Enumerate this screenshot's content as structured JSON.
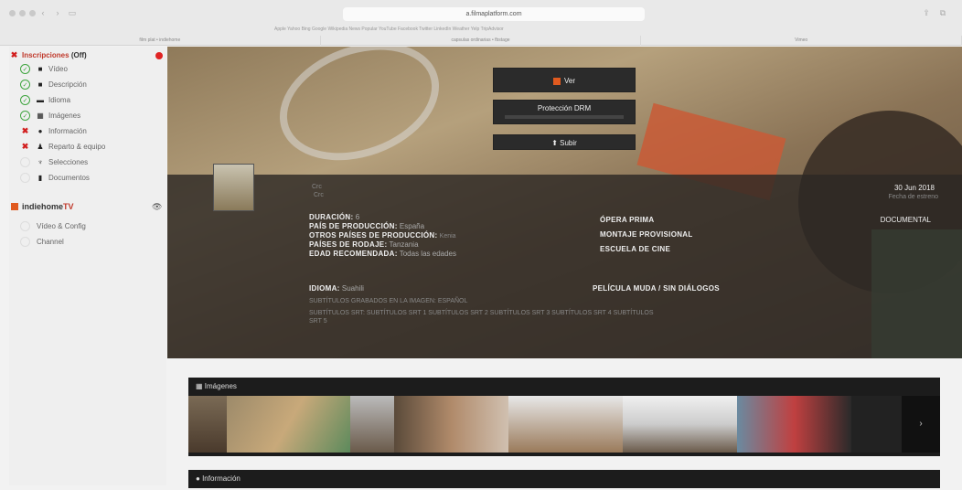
{
  "browser": {
    "url": "a.filmaplatform.com",
    "bookmarks": "Apple  Yahoo  Bing  Google  Wikipedia  News  Popular  YouTube  Facebook  Twitter  LinkedIn  Weather  Yelp  TripAdvisor",
    "tabs": [
      "film plat • indiehome",
      "capsulas ordinarias • fbstage",
      "Vimeo"
    ]
  },
  "sidebar": {
    "inscripciones_title": "Inscripciones",
    "inscripciones_status": "(Off)",
    "items": [
      {
        "label": "Vídeo",
        "state": "ok",
        "icon": "document-icon"
      },
      {
        "label": "Descripción",
        "state": "ok",
        "icon": "document-icon"
      },
      {
        "label": "Idioma",
        "state": "ok",
        "icon": "language-icon"
      },
      {
        "label": "Imágenes",
        "state": "ok",
        "icon": "image-icon"
      },
      {
        "label": "Información",
        "state": "bad",
        "icon": "info-icon"
      },
      {
        "label": "Reparto & equipo",
        "state": "bad",
        "icon": "people-icon"
      },
      {
        "label": "Selecciones",
        "state": "empty",
        "icon": "trophy-icon"
      },
      {
        "label": "Documentos",
        "state": "empty",
        "icon": "file-icon"
      }
    ],
    "indiehome_title": "indiehome",
    "indiehome_tv": "TV",
    "indiehome_items": [
      "Vídeo & Config",
      "Channel"
    ]
  },
  "hero": {
    "ver_label": "Ver",
    "drm_label": "Protección DRM",
    "subir_label": "Subir",
    "small_meta1": "Crc",
    "small_meta2": "Crc",
    "date": "30 Jun 2018",
    "date_label": "Fecha de estreno",
    "genre": "DOCUMENTAL",
    "duracion_label": "DURACIÓN:",
    "duracion_value": "6",
    "pais_label": "PAÍS DE PRODUCCIÓN:",
    "pais_value": "España",
    "otros_label": "OTROS PAÍSES DE PRODUCCIÓN:",
    "otros_value": "Kenia",
    "rodaje_label": "PAÍSES DE RODAJE:",
    "rodaje_value": "Tanzania",
    "edad_label": "EDAD RECOMENDADA:",
    "edad_value": "Todas las edades",
    "opera_prima": "ÓPERA PRIMA",
    "montaje": "MONTAJE PROVISIONAL",
    "escuela": "ESCUELA DE CINE",
    "idioma_label": "IDIOMA:",
    "idioma_value": "Suahili",
    "muda": "PELÍCULA MUDA / SIN DIÁLOGOS",
    "subtitulos_grabados": "SUBTÍTULOS GRABADOS EN LA IMAGEN:",
    "subtitulos_grabados_value": "ESPAÑOL",
    "subtitulos_srt": "SUBTÍTULOS SRT:   SUBTÍTULOS SRT 1  SUBTÍTULOS SRT 2  SUBTÍTULOS SRT 3  SUBTÍTULOS SRT 4  SUBTÍTULOS",
    "subtitulos_srt2": "SRT 5"
  },
  "gallery": {
    "title": "Imágenes",
    "next": "›"
  },
  "info": {
    "title": "Información"
  },
  "colors": {
    "accent_red": "#e02424",
    "accent_orange": "#e05a1f",
    "ok_green": "#3fa53f",
    "dark_panel": "#1c1c1c"
  }
}
